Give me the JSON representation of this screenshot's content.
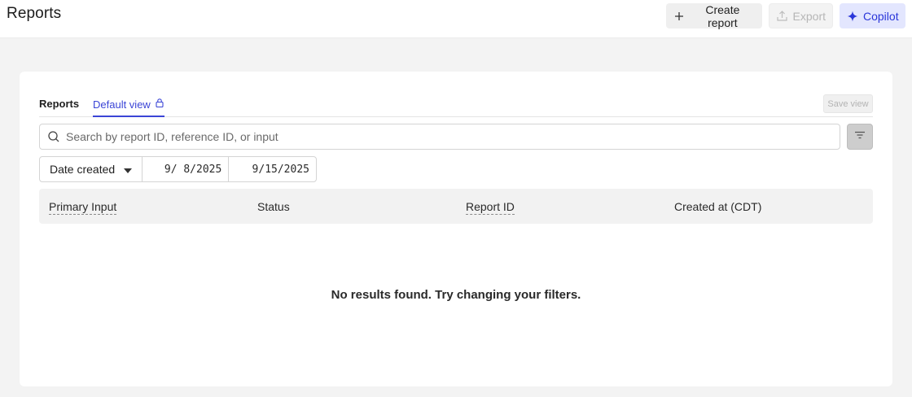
{
  "header": {
    "title": "Reports",
    "create_label": "Create report",
    "export_label": "Export",
    "copilot_label": "Copilot"
  },
  "tabs": {
    "reports_label": "Reports",
    "default_view_label": "Default view",
    "save_view_label": "Save view"
  },
  "search": {
    "placeholder": "Search by report ID, reference ID, or input"
  },
  "date_filter": {
    "field": "Date created",
    "start": " 9/ 8/2025",
    "end": " 9/15/2025"
  },
  "table": {
    "columns": [
      "Primary Input",
      "Status",
      "Report ID",
      "Created at (CDT)"
    ]
  },
  "empty_message": "No results found. Try changing your filters.",
  "colors": {
    "accent": "#3b45d6",
    "copilot_bg": "#e3e6fe",
    "page_bg": "#f3f3f3"
  }
}
